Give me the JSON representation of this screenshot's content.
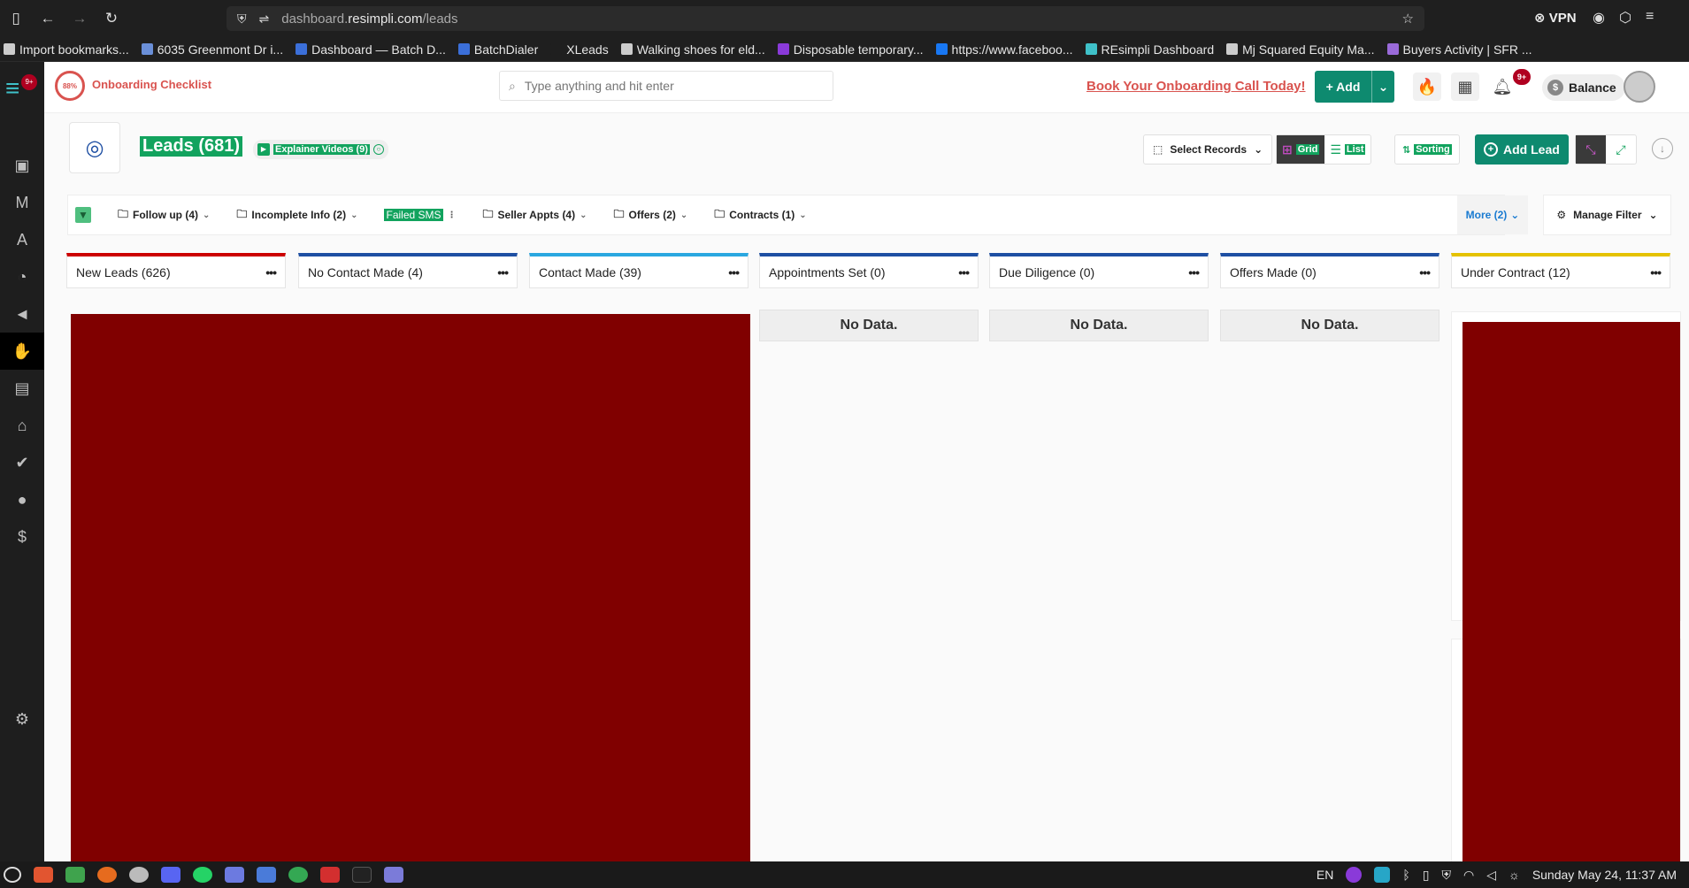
{
  "browser": {
    "url_prefix": "dashboard.",
    "url_host": "resimpli.com",
    "url_path": "/leads",
    "vpn_label": "VPN",
    "bookmarks": [
      {
        "label": "Import bookmarks...",
        "color": "#cccccc"
      },
      {
        "label": "6035 Greenmont Dr i...",
        "color": "#6a8fd8"
      },
      {
        "label": "Dashboard — Batch D...",
        "color": "#3b6fd9"
      },
      {
        "label": "BatchDialer",
        "color": "#3b6fd9"
      },
      {
        "label": "XLeads",
        "color": "#1f1f1f"
      },
      {
        "label": "Walking shoes for eld...",
        "color": "#cccccc"
      },
      {
        "label": "Disposable temporary...",
        "color": "#8a3ad9"
      },
      {
        "label": "https://www.faceboo...",
        "color": "#1877f2"
      },
      {
        "label": "REsimpli Dashboard",
        "color": "#3fc1c9"
      },
      {
        "label": "Mj Squared Equity Ma...",
        "color": "#cccccc"
      },
      {
        "label": "Buyers Activity | SFR ...",
        "color": "#9a6ad9"
      }
    ]
  },
  "header": {
    "onboarding_percent": "88%",
    "onboarding_label": "Onboarding Checklist",
    "search_placeholder": "Type anything and hit enter",
    "book_call": "Book Your Onboarding Call Today!",
    "add_label": "Add",
    "notif_count": "9+",
    "balance_label": "Balance",
    "rail_badge": "9+"
  },
  "page": {
    "title": "Leads (681)",
    "explainer": "Explainer Videos (9)",
    "select_records": "Select Records",
    "grid_label": "Grid",
    "list_label": "List",
    "sorting_label": "Sorting",
    "add_lead": "Add Lead"
  },
  "filters": {
    "chips": [
      {
        "label": "Follow up (4)"
      },
      {
        "label": "Incomplete Info (2)"
      },
      {
        "label": "Seller Appts (4)"
      },
      {
        "label": "Offers (2)"
      },
      {
        "label": "Contracts (1)"
      }
    ],
    "failed_sms": "Failed SMS",
    "more": "More (2)",
    "manage": "Manage Filter"
  },
  "columns": [
    {
      "title": "New Leads (626)",
      "color": "#cc0000"
    },
    {
      "title": "No Contact Made (4)",
      "color": "#1e4fa3"
    },
    {
      "title": "Contact Made (39)",
      "color": "#2aa7e0"
    },
    {
      "title": "Appointments Set (0)",
      "color": "#1e4fa3"
    },
    {
      "title": "Due Diligence (0)",
      "color": "#1e4fa3"
    },
    {
      "title": "Offers Made (0)",
      "color": "#1e4fa3"
    },
    {
      "title": "Under Contract (12)",
      "color": "#e5c200"
    }
  ],
  "no_data": "No Data.",
  "taskbar": {
    "lang": "EN",
    "datetime": "Sunday May 24, 11:37 AM"
  }
}
